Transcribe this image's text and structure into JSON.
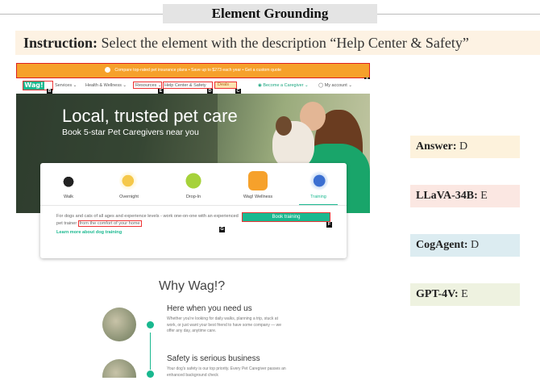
{
  "header": {
    "title": "Element Grounding"
  },
  "instruction": {
    "label": "Instruction:",
    "text": "Select the element with the description “Help Center & Safety”"
  },
  "screenshot": {
    "promo_text": "Compare top-rated pet insurance plans • Save up to $273 each year • Get a custom quote",
    "nav": {
      "logo": "Wag!",
      "items": [
        "Services ⌄",
        "Health & Wellness ⌄",
        "Resources ⌄",
        "Help Center & Safety",
        "Deals"
      ],
      "caregiver": "Become a Caregiver ⌄",
      "account": "My account ⌄"
    },
    "hero": {
      "title": "Local, trusted pet care",
      "subtitle": "Book 5-star Pet Caregivers near you"
    },
    "services": [
      "Walk",
      "Overnight",
      "Drop-In",
      "Wag! Wellness",
      "Training"
    ],
    "description": {
      "before": "For dogs and cats of all ages and experience levels - work one-on-one with an experienced pet trainer",
      "highlight": "from the comfort of your home"
    },
    "learn_more": "Learn more about dog training",
    "book_button": "Book training",
    "why_title": "Why Wag!?",
    "features": [
      {
        "title": "Here when you need us",
        "body": "Whether you're looking for daily walks, planning a trip, stuck at work, or just want your best friend to have some company — we offer any day, anytime care."
      },
      {
        "title": "Safety is serious business",
        "body": "Your dog's safety is our top priority. Every Pet Caregiver passes an enhanced background check"
      }
    ],
    "tags": [
      "A",
      "B",
      "C",
      "D",
      "E",
      "F",
      "G"
    ]
  },
  "answers": [
    {
      "label": "Answer:",
      "value": "D",
      "color": "#fdf2dc"
    },
    {
      "label": "LLaVA-34B:",
      "value": "E",
      "color": "#fbe7e2"
    },
    {
      "label": "CogAgent:",
      "value": "D",
      "color": "#dcecf1"
    },
    {
      "label": "GPT-4V:",
      "value": "E",
      "color": "#eef2e0"
    }
  ]
}
